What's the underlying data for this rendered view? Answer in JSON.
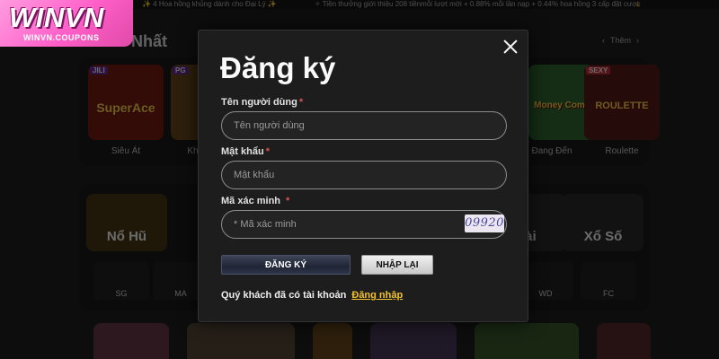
{
  "ticker": {
    "left_text": "✨ 4 Hoa hồng khủng dành cho Đại Lý ✨",
    "right_text": "✧ Tiền thưởng giới thiệu 208 tiềnmỗi lượt mời + 0.88% mỗi lần nạp + 0.44% hoa hồng 3 cấp đặt cược"
  },
  "brand": {
    "logo_text": "WINVN",
    "logo_subtext": "WINVN.COUPONS"
  },
  "background": {
    "section_title": "Nhất",
    "more_label": "Thêm",
    "games": [
      {
        "provider": "JILI",
        "art_text": "SuperAce",
        "label": "Siêu Át",
        "color": "#7a1d14"
      },
      {
        "provider": "PG",
        "art_text": "",
        "label": "Kho B",
        "color": "#6a4a1a"
      },
      {
        "provider": "",
        "art_text": "",
        "label": "",
        "color": "#2a4a2a"
      },
      {
        "provider": "",
        "art_text": "",
        "label": "",
        "color": "#24364f"
      },
      {
        "provider": "",
        "art_text": "",
        "label": "",
        "color": "#4a2a3a"
      },
      {
        "provider": "",
        "art_text": "Money Coming",
        "label": "Đang Đến",
        "color": "#2f6a2f"
      },
      {
        "provider": "SEXY",
        "art_text": "ROULETTE",
        "label": "Roulette",
        "color": "#5a1a1a"
      }
    ],
    "categories": [
      {
        "label": "Nổ Hũ",
        "color": "#4a3a12"
      },
      {
        "label": "",
        "color": "#2a2a2a"
      },
      {
        "label": "",
        "color": "#2a2a2a"
      },
      {
        "label": "",
        "color": "#2a2a2a"
      },
      {
        "label": "Bài",
        "color": "#2a2a2a"
      },
      {
        "label": "Xổ Số",
        "color": "#2a2a2a"
      }
    ],
    "providers": [
      {
        "label": "SG"
      },
      {
        "label": "MA"
      },
      {
        "label": "WD"
      },
      {
        "label": "FC"
      }
    ]
  },
  "modal": {
    "title": "Đăng ký",
    "username_label": "Tên người dùng",
    "username_placeholder": "Tên người dùng",
    "password_label": "Mật khẩu",
    "password_placeholder": "Mật khẩu",
    "captcha_label": "Mã xác minh",
    "captcha_placeholder": "* Mã xác minh",
    "captcha_code": "09920",
    "required_mark": "*",
    "register_button": "ĐĂNG KÝ",
    "reset_button": "NHẬP LẠI",
    "login_prompt": "Quý khách đã có tài khoản",
    "login_link": "Đăng nhập"
  }
}
